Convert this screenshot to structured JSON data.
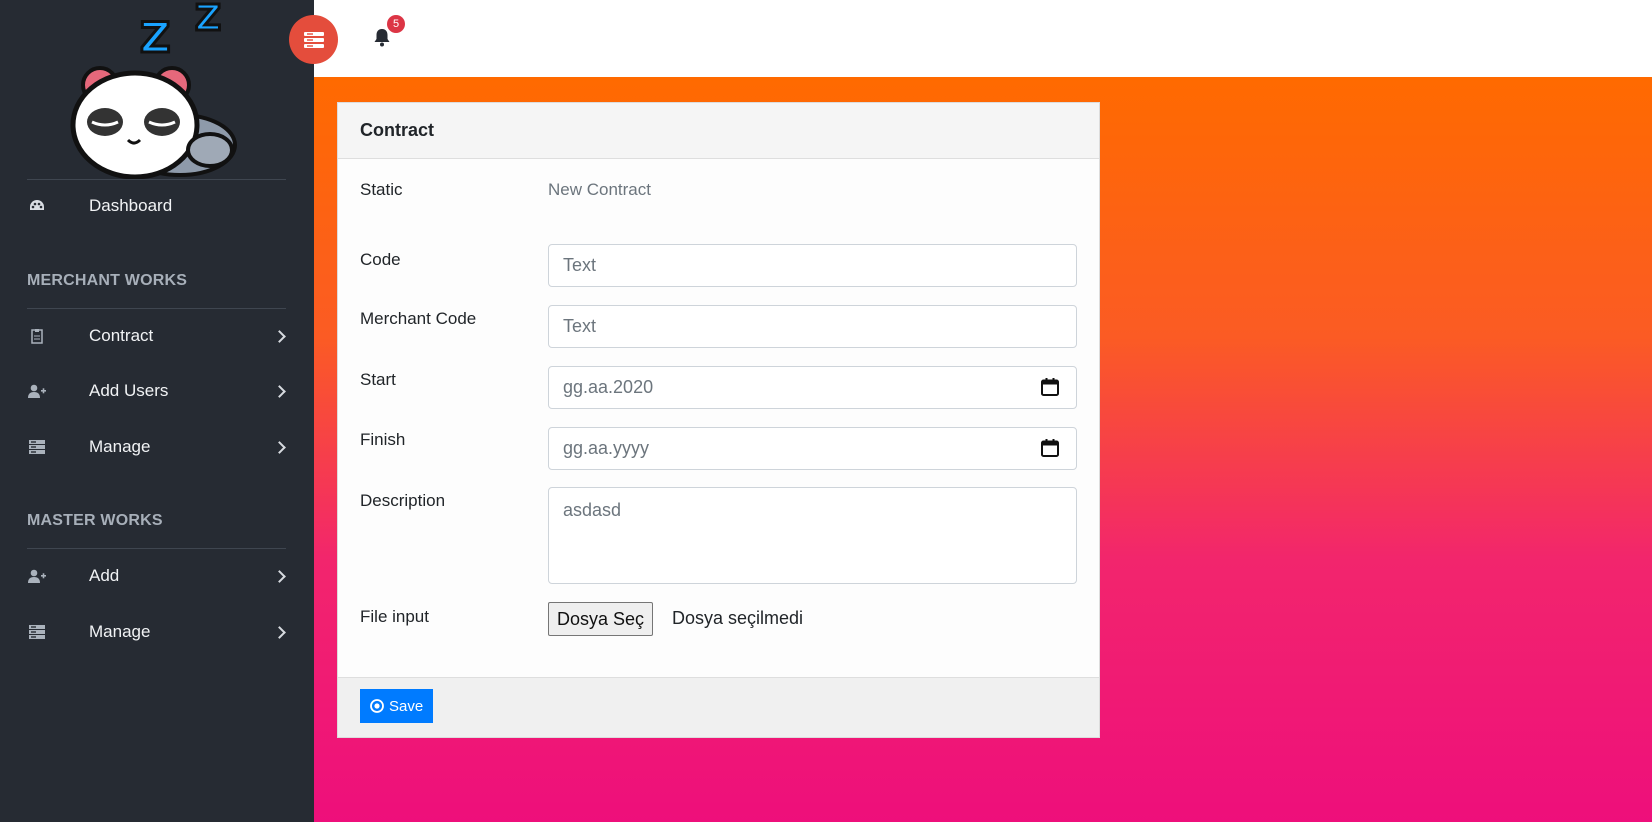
{
  "sidebar": {
    "dashboard": {
      "label": "Dashboard",
      "icon": "palette-icon"
    },
    "sections": [
      {
        "heading": "MERCHANT WORKS",
        "items": [
          {
            "label": "Contract",
            "icon": "clipboard-icon"
          },
          {
            "label": "Add Users",
            "icon": "user-plus-icon"
          },
          {
            "label": "Manage",
            "icon": "server-icon"
          }
        ]
      },
      {
        "heading": "MASTER WORKS",
        "items": [
          {
            "label": "Add",
            "icon": "user-plus-icon"
          },
          {
            "label": "Manage",
            "icon": "server-icon"
          }
        ]
      }
    ]
  },
  "topbar": {
    "notification_count": "5",
    "menu_icon": "menu-icon",
    "bell_icon": "bell-icon"
  },
  "form": {
    "title": "Contract",
    "static": {
      "label": "Static",
      "value": "New Contract"
    },
    "code": {
      "label": "Code",
      "placeholder": "Text"
    },
    "merchant_code": {
      "label": "Merchant Code",
      "placeholder": "Text"
    },
    "start": {
      "label": "Start",
      "value": "gg.aa.2020"
    },
    "finish": {
      "label": "Finish",
      "value": "gg.aa.yyyy"
    },
    "description": {
      "label": "Description",
      "value": "asdasd"
    },
    "file_input": {
      "label": "File input",
      "button": "Dosya Seç",
      "status": "Dosya seçilmedi"
    },
    "save_label": "Save"
  },
  "colors": {
    "sidebar_bg": "#262b33",
    "menu_button": "#e44d3c",
    "badge": "#dc3545",
    "primary": "#007bff",
    "gradient_top": "#ff6a00",
    "gradient_bottom": "#ee0f7b"
  }
}
